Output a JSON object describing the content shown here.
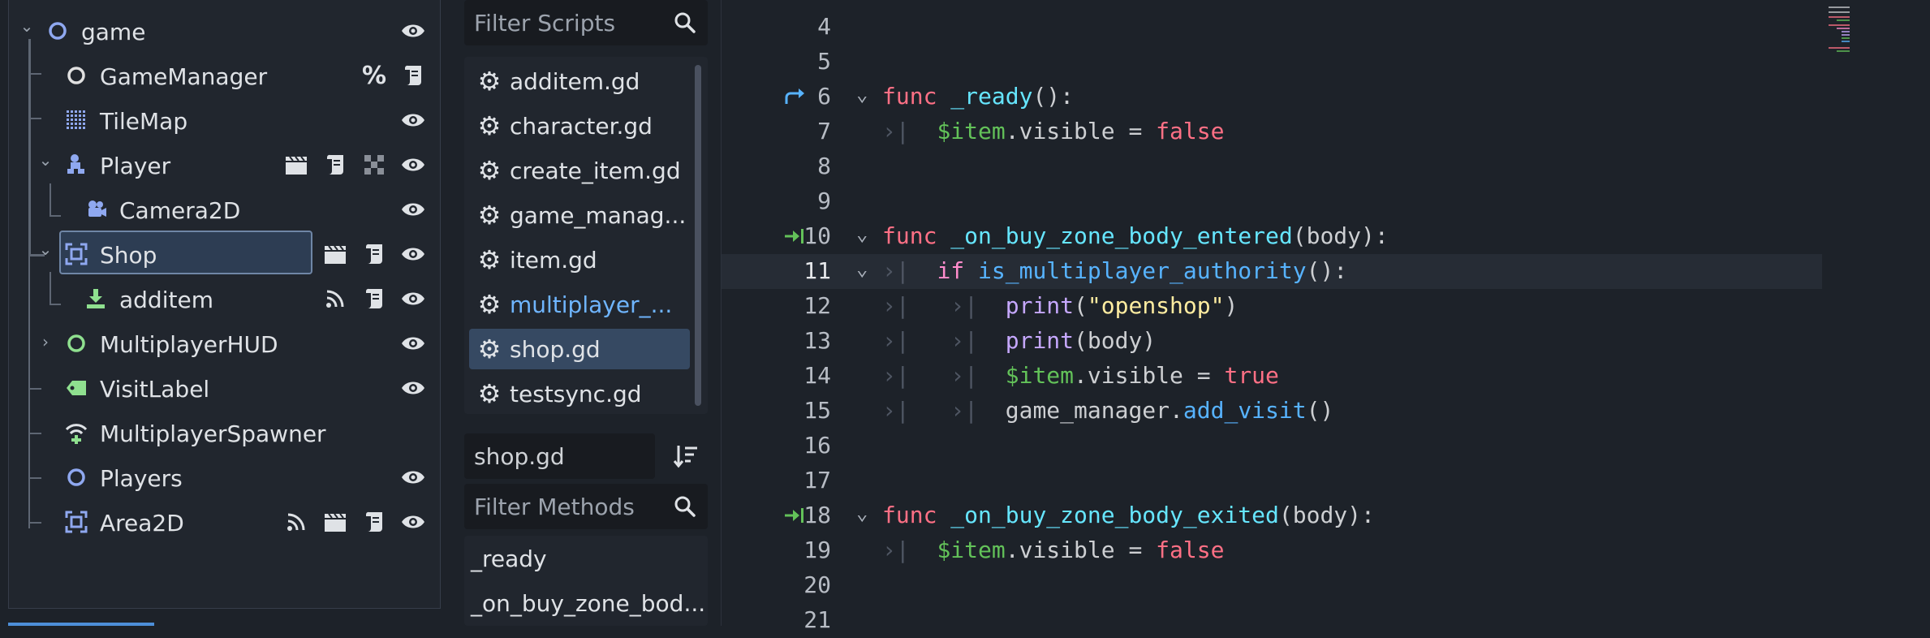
{
  "scene_tree": {
    "nodes": [
      {
        "label": "game",
        "icon": "node-ring-icon",
        "color": "#8fa8f0",
        "expanded": true,
        "badges": [
          "visibility-icon"
        ]
      },
      {
        "label": "GameManager",
        "icon": "node-ring-icon",
        "color": "#e0e0e0",
        "badges": [
          "percent-icon",
          "script-icon"
        ]
      },
      {
        "label": "TileMap",
        "icon": "tilemap-icon",
        "color": "#8fa8f0",
        "badges": [
          "visibility-icon"
        ]
      },
      {
        "label": "Player",
        "icon": "character-body-icon",
        "color": "#8fa8f0",
        "expanded": true,
        "badges": [
          "clapperboard-icon",
          "script-icon",
          "checker-icon",
          "visibility-icon"
        ]
      },
      {
        "label": "Camera2D",
        "icon": "camera-icon",
        "color": "#8fa8f0",
        "badges": [
          "visibility-icon"
        ]
      },
      {
        "label": "Shop",
        "icon": "area2d-icon",
        "color": "#8fa8f0",
        "expanded": true,
        "selected": true,
        "badges": [
          "clapperboard-icon",
          "script-icon",
          "visibility-icon"
        ]
      },
      {
        "label": "additem",
        "icon": "button-down-icon",
        "color": "#8fe08f",
        "badges": [
          "signal-icon",
          "script-icon",
          "visibility-icon"
        ]
      },
      {
        "label": "MultiplayerHUD",
        "icon": "node-ring-icon",
        "color": "#8fe08f",
        "collapsed": true,
        "badges": [
          "visibility-icon"
        ]
      },
      {
        "label": "VisitLabel",
        "icon": "label-tag-icon",
        "color": "#8fe08f",
        "badges": [
          "visibility-icon"
        ]
      },
      {
        "label": "MultiplayerSpawner",
        "icon": "multiplayer-spawner-icon",
        "color": "#dfe2e6",
        "badges": []
      },
      {
        "label": "Players",
        "icon": "node-ring-icon",
        "color": "#8fa8f0",
        "badges": [
          "visibility-icon"
        ]
      },
      {
        "label": "Area2D",
        "icon": "area2d-icon",
        "color": "#8fa8f0",
        "badges": [
          "signal-icon",
          "clapperboard-icon",
          "script-icon",
          "visibility-icon"
        ]
      }
    ]
  },
  "scripts_panel": {
    "filter_placeholder": "Filter Scripts",
    "scripts": [
      {
        "label": "additem.gd"
      },
      {
        "label": "character.gd"
      },
      {
        "label": "create_item.gd"
      },
      {
        "label": "game_manag..."
      },
      {
        "label": "item.gd"
      },
      {
        "label": "multiplayer_...",
        "modified": true
      },
      {
        "label": "shop.gd",
        "selected": true
      },
      {
        "label": "testsync.gd"
      }
    ],
    "current_script": "shop.gd",
    "methods_filter_placeholder": "Filter Methods",
    "methods": [
      "_ready",
      "_on_buy_zone_bod..."
    ]
  },
  "editor": {
    "current_line": 11,
    "lines": [
      {
        "n": "4",
        "code": ""
      },
      {
        "n": "5",
        "code": ""
      },
      {
        "n": "6",
        "code": "func _ready():",
        "marker": "override"
      },
      {
        "n": "7",
        "code": "\t$item.visible = false"
      },
      {
        "n": "8",
        "code": ""
      },
      {
        "n": "9",
        "code": ""
      },
      {
        "n": "10",
        "code": "func _on_buy_zone_body_entered(body):",
        "marker": "signal"
      },
      {
        "n": "11",
        "code": "\tif is_multiplayer_authority():"
      },
      {
        "n": "12",
        "code": "\t\tprint(\"openshop\")"
      },
      {
        "n": "13",
        "code": "\t\tprint(body)"
      },
      {
        "n": "14",
        "code": "\t\t$item.visible = true"
      },
      {
        "n": "15",
        "code": "\t\tgame_manager.add_visit()"
      },
      {
        "n": "16",
        "code": ""
      },
      {
        "n": "17",
        "code": ""
      },
      {
        "n": "18",
        "code": "func _on_buy_zone_body_exited(body):",
        "marker": "signal"
      },
      {
        "n": "19",
        "code": "\t$item.visible = false"
      },
      {
        "n": "20",
        "code": ""
      },
      {
        "n": "21",
        "code": ""
      }
    ]
  },
  "colors": {
    "accent": "#4d8fd9",
    "keyword": "#ff7085",
    "function": "#57b3ff",
    "node_path": "#63c259",
    "string": "#ffeda1",
    "selection": "#364962"
  }
}
